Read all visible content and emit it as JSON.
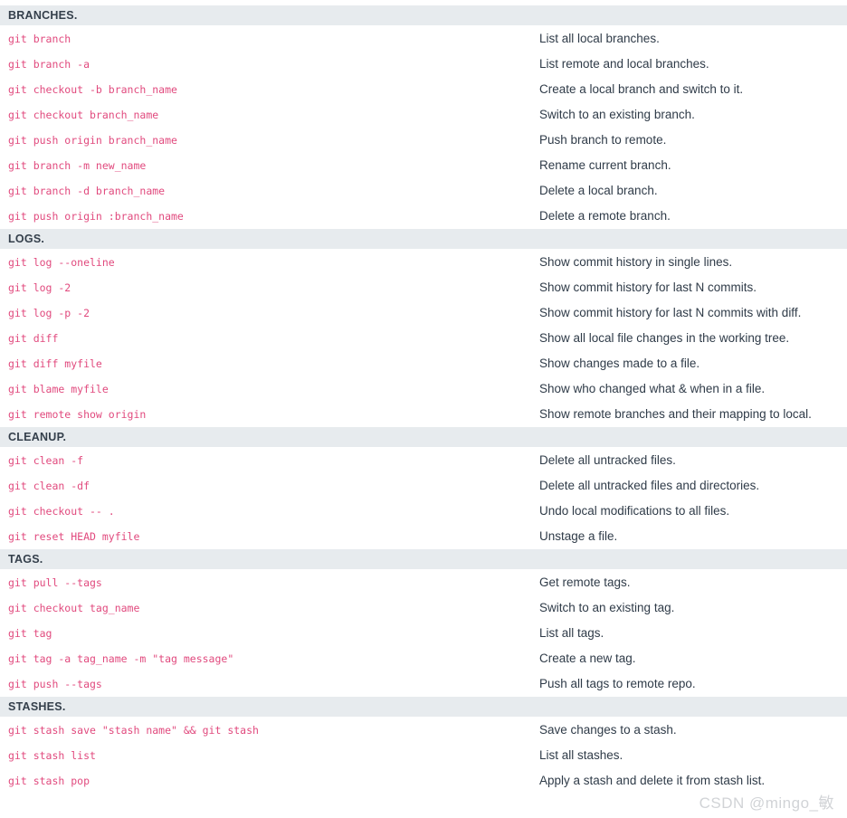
{
  "colors": {
    "header_bg": "#e7ebee",
    "header_text": "#343f4b",
    "command_text": "#e14a7e",
    "description_text": "#2f3b48",
    "page_bg": "#ffffff",
    "watermark_text": "#c9ccd0"
  },
  "watermark": "CSDN @mingo_敏",
  "sections": [
    {
      "title": "BRANCHES.",
      "rows": [
        {
          "command": "git branch",
          "description": "List all local branches."
        },
        {
          "command": "git branch -a",
          "description": "List remote and local branches."
        },
        {
          "command": "git checkout -b branch_name",
          "description": "Create a local branch and switch to it."
        },
        {
          "command": "git checkout branch_name",
          "description": "Switch to an existing branch."
        },
        {
          "command": "git push origin branch_name",
          "description": "Push branch to remote."
        },
        {
          "command": "git branch -m new_name",
          "description": "Rename current branch."
        },
        {
          "command": "git branch -d branch_name",
          "description": "Delete a local branch."
        },
        {
          "command": "git push origin :branch_name",
          "description": "Delete a remote branch."
        }
      ]
    },
    {
      "title": "LOGS.",
      "rows": [
        {
          "command": "git log --oneline",
          "description": "Show commit history in single lines."
        },
        {
          "command": "git log -2",
          "description": "Show commit history for last N commits."
        },
        {
          "command": "git log -p -2",
          "description": "Show commit history for last N commits with diff."
        },
        {
          "command": "git diff",
          "description": "Show all local file changes in the working tree."
        },
        {
          "command": "git diff myfile",
          "description": "Show changes made to a file."
        },
        {
          "command": "git blame myfile",
          "description": "Show who changed what & when in a file."
        },
        {
          "command": "git remote show origin",
          "description": "Show remote branches and their mapping to local."
        }
      ]
    },
    {
      "title": "CLEANUP.",
      "rows": [
        {
          "command": "git clean -f",
          "description": "Delete all untracked files."
        },
        {
          "command": "git clean -df",
          "description": "Delete all untracked files and directories."
        },
        {
          "command": "git checkout -- .",
          "description": "Undo local modifications to all files."
        },
        {
          "command": "git reset HEAD myfile",
          "description": "Unstage a file."
        }
      ]
    },
    {
      "title": "TAGS.",
      "rows": [
        {
          "command": "git pull --tags",
          "description": "Get remote tags."
        },
        {
          "command": "git checkout tag_name",
          "description": "Switch to an existing tag."
        },
        {
          "command": "git tag",
          "description": "List all tags."
        },
        {
          "command": "git tag -a tag_name -m \"tag message\"",
          "description": "Create a new tag."
        },
        {
          "command": "git push --tags",
          "description": "Push all tags to remote repo."
        }
      ]
    },
    {
      "title": "STASHES.",
      "rows": [
        {
          "command": "git stash save \"stash name\" && git stash",
          "description": "Save changes to a stash."
        },
        {
          "command": "git stash list",
          "description": "List all stashes."
        },
        {
          "command": "git stash pop",
          "description": "Apply a stash and delete it from stash list."
        }
      ]
    }
  ]
}
